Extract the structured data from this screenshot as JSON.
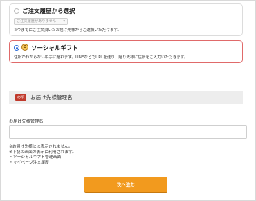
{
  "history_option": {
    "title": "ご注文履歴から選択",
    "select_value": "ご注文履歴がありません",
    "description": "※今までにご注文頂いたお届け先様からご選択いただけます。"
  },
  "social_option": {
    "title": "ソーシャルギフト",
    "icon": "gift-icon",
    "description": "住所がわからない相手に贈れます。LINEなどでURLを送り、贈り先様に住所をご入力いただきます。"
  },
  "recipient_section": {
    "required_badge": "必須",
    "title": "お届け先様管理名",
    "field_label": "お届け先様管理名",
    "field_value": "",
    "notes": [
      "※お届け先様には表示されません。",
      "※下記の画面の表示に利用されます。",
      "・ソーシャルギフト管理画面",
      "・マイページ注文履歴"
    ]
  },
  "next_button": {
    "label": "次へ進む"
  },
  "colors": {
    "accent_orange": "#f29a1e",
    "selected_border": "#e06a6a",
    "required_badge": "#c0392b",
    "radio_selected": "#2a6bd8"
  }
}
